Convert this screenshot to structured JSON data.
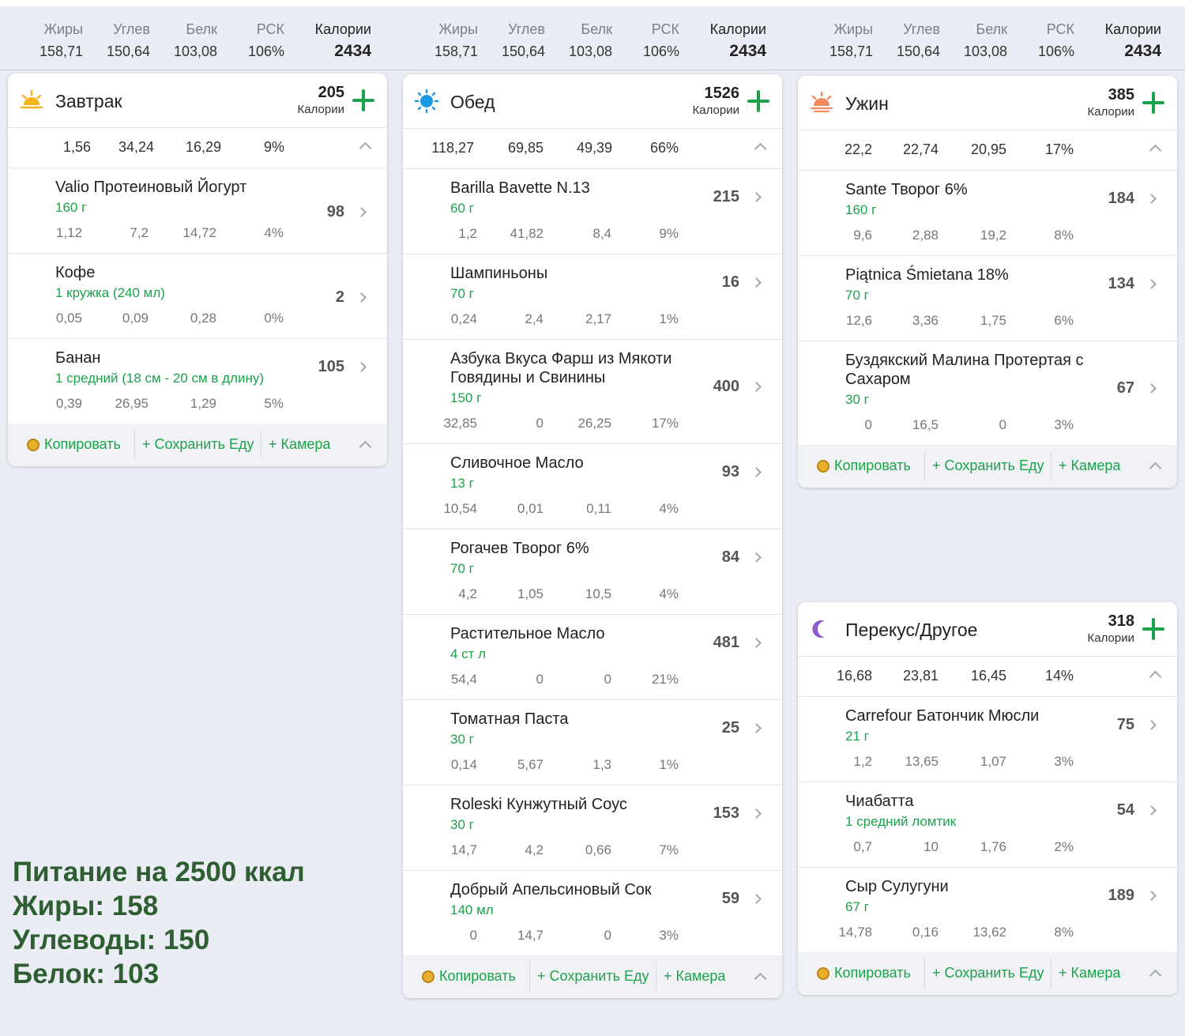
{
  "summary": {
    "labels": {
      "fat": "Жиры",
      "carbs": "Углев",
      "protein": "Белк",
      "rdi": "РСК",
      "calories": "Калории"
    },
    "values": {
      "fat": "158,71",
      "carbs": "150,64",
      "protein": "103,08",
      "rdi": "106%",
      "calories": "2434"
    }
  },
  "common": {
    "calories_unit": "Калории",
    "copy": "Копировать",
    "save_food": "+ Сохранить Еду",
    "camera": "+ Камера"
  },
  "meals": {
    "breakfast": {
      "title": "Завтрак",
      "calories": "205",
      "totals": [
        "1,56",
        "34,24",
        "16,29",
        "9%"
      ],
      "items": [
        {
          "name": "Valio Протеиновый Йогурт",
          "qty": "160 г",
          "cal": "98",
          "macros": [
            "1,12",
            "7,2",
            "14,72",
            "4%"
          ]
        },
        {
          "name": "Кофе",
          "qty": "1 кружка (240 мл)",
          "cal": "2",
          "macros": [
            "0,05",
            "0,09",
            "0,28",
            "0%"
          ]
        },
        {
          "name": "Банан",
          "qty": "1 средний (18 см - 20 см в длину)",
          "cal": "105",
          "macros": [
            "0,39",
            "26,95",
            "1,29",
            "5%"
          ]
        }
      ]
    },
    "lunch": {
      "title": "Обед",
      "calories": "1526",
      "totals": [
        "118,27",
        "69,85",
        "49,39",
        "66%"
      ],
      "items": [
        {
          "name": "Barilla Bavette N.13",
          "qty": "60 г",
          "cal": "215",
          "macros": [
            "1,2",
            "41,82",
            "8,4",
            "9%"
          ]
        },
        {
          "name": "Шампиньоны",
          "qty": "70 г",
          "cal": "16",
          "macros": [
            "0,24",
            "2,4",
            "2,17",
            "1%"
          ]
        },
        {
          "name": "Азбука Вкуса Фарш из Мякоти Говядины и Свинины",
          "qty": "150 г",
          "cal": "400",
          "macros": [
            "32,85",
            "0",
            "26,25",
            "17%"
          ]
        },
        {
          "name": "Сливочное Масло",
          "qty": "13 г",
          "cal": "93",
          "macros": [
            "10,54",
            "0,01",
            "0,11",
            "4%"
          ]
        },
        {
          "name": "Рогачев Творог 6%",
          "qty": "70 г",
          "cal": "84",
          "macros": [
            "4,2",
            "1,05",
            "10,5",
            "4%"
          ]
        },
        {
          "name": "Растительное Масло",
          "qty": "4 ст л",
          "cal": "481",
          "macros": [
            "54,4",
            "0",
            "0",
            "21%"
          ]
        },
        {
          "name": "Томатная Паста",
          "qty": "30 г",
          "cal": "25",
          "macros": [
            "0,14",
            "5,67",
            "1,3",
            "1%"
          ]
        },
        {
          "name": "Roleski Кунжутный Соус",
          "qty": "30 г",
          "cal": "153",
          "macros": [
            "14,7",
            "4,2",
            "0,66",
            "7%"
          ]
        },
        {
          "name": "Добрый Апельсиновый Сок",
          "qty": "140 мл",
          "cal": "59",
          "macros": [
            "0",
            "14,7",
            "0",
            "3%"
          ]
        }
      ]
    },
    "dinner": {
      "title": "Ужин",
      "calories": "385",
      "totals": [
        "22,2",
        "22,74",
        "20,95",
        "17%"
      ],
      "items": [
        {
          "name": "Sante Творог 6%",
          "qty": "160 г",
          "cal": "184",
          "macros": [
            "9,6",
            "2,88",
            "19,2",
            "8%"
          ]
        },
        {
          "name": "Piątnica Śmietana 18%",
          "qty": "70 г",
          "cal": "134",
          "macros": [
            "12,6",
            "3,36",
            "1,75",
            "6%"
          ]
        },
        {
          "name": "Буздякский Малина Протертая с Сахаром",
          "qty": "30 г",
          "cal": "67",
          "macros": [
            "0",
            "16,5",
            "0",
            "3%"
          ]
        }
      ]
    },
    "snack": {
      "title": "Перекус/Другое",
      "calories": "318",
      "totals": [
        "16,68",
        "23,81",
        "16,45",
        "14%"
      ],
      "items": [
        {
          "name": "Carrefour Батончик Мюсли",
          "qty": "21 г",
          "cal": "75",
          "macros": [
            "1,2",
            "13,65",
            "1,07",
            "3%"
          ]
        },
        {
          "name": "Чиабатта",
          "qty": "1 средний ломтик",
          "cal": "54",
          "macros": [
            "0,7",
            "10",
            "1,76",
            "2%"
          ]
        },
        {
          "name": "Сыр Сулугуни",
          "qty": "67 г",
          "cal": "189",
          "macros": [
            "14,78",
            "0,16",
            "13,62",
            "8%"
          ]
        }
      ]
    }
  },
  "promo": {
    "line1": "Питание на 2500 ккал",
    "line2": "Жиры: 158",
    "line3": "Углеводы: 150",
    "line4": "Белок: 103"
  },
  "colors": {
    "accent_green": "#1aa34a",
    "promo_green": "#2f5e33",
    "background": "#ebedf4"
  },
  "icons": {
    "breakfast": "sunrise-icon",
    "lunch": "sun-icon",
    "dinner": "sunset-icon",
    "snack": "moon-icon"
  }
}
